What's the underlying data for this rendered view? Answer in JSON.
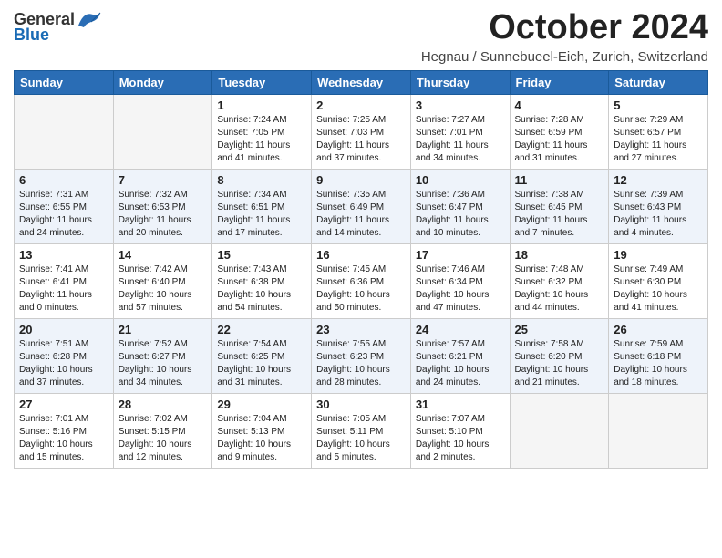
{
  "header": {
    "logo_general": "General",
    "logo_blue": "Blue",
    "month_title": "October 2024",
    "subtitle": "Hegnau / Sunnebueel-Eich, Zurich, Switzerland"
  },
  "days_of_week": [
    "Sunday",
    "Monday",
    "Tuesday",
    "Wednesday",
    "Thursday",
    "Friday",
    "Saturday"
  ],
  "weeks": [
    [
      {
        "day": "",
        "empty": true
      },
      {
        "day": "",
        "empty": true
      },
      {
        "day": "1",
        "sunrise": "Sunrise: 7:24 AM",
        "sunset": "Sunset: 7:05 PM",
        "daylight": "Daylight: 11 hours and 41 minutes."
      },
      {
        "day": "2",
        "sunrise": "Sunrise: 7:25 AM",
        "sunset": "Sunset: 7:03 PM",
        "daylight": "Daylight: 11 hours and 37 minutes."
      },
      {
        "day": "3",
        "sunrise": "Sunrise: 7:27 AM",
        "sunset": "Sunset: 7:01 PM",
        "daylight": "Daylight: 11 hours and 34 minutes."
      },
      {
        "day": "4",
        "sunrise": "Sunrise: 7:28 AM",
        "sunset": "Sunset: 6:59 PM",
        "daylight": "Daylight: 11 hours and 31 minutes."
      },
      {
        "day": "5",
        "sunrise": "Sunrise: 7:29 AM",
        "sunset": "Sunset: 6:57 PM",
        "daylight": "Daylight: 11 hours and 27 minutes."
      }
    ],
    [
      {
        "day": "6",
        "sunrise": "Sunrise: 7:31 AM",
        "sunset": "Sunset: 6:55 PM",
        "daylight": "Daylight: 11 hours and 24 minutes."
      },
      {
        "day": "7",
        "sunrise": "Sunrise: 7:32 AM",
        "sunset": "Sunset: 6:53 PM",
        "daylight": "Daylight: 11 hours and 20 minutes."
      },
      {
        "day": "8",
        "sunrise": "Sunrise: 7:34 AM",
        "sunset": "Sunset: 6:51 PM",
        "daylight": "Daylight: 11 hours and 17 minutes."
      },
      {
        "day": "9",
        "sunrise": "Sunrise: 7:35 AM",
        "sunset": "Sunset: 6:49 PM",
        "daylight": "Daylight: 11 hours and 14 minutes."
      },
      {
        "day": "10",
        "sunrise": "Sunrise: 7:36 AM",
        "sunset": "Sunset: 6:47 PM",
        "daylight": "Daylight: 11 hours and 10 minutes."
      },
      {
        "day": "11",
        "sunrise": "Sunrise: 7:38 AM",
        "sunset": "Sunset: 6:45 PM",
        "daylight": "Daylight: 11 hours and 7 minutes."
      },
      {
        "day": "12",
        "sunrise": "Sunrise: 7:39 AM",
        "sunset": "Sunset: 6:43 PM",
        "daylight": "Daylight: 11 hours and 4 minutes."
      }
    ],
    [
      {
        "day": "13",
        "sunrise": "Sunrise: 7:41 AM",
        "sunset": "Sunset: 6:41 PM",
        "daylight": "Daylight: 11 hours and 0 minutes."
      },
      {
        "day": "14",
        "sunrise": "Sunrise: 7:42 AM",
        "sunset": "Sunset: 6:40 PM",
        "daylight": "Daylight: 10 hours and 57 minutes."
      },
      {
        "day": "15",
        "sunrise": "Sunrise: 7:43 AM",
        "sunset": "Sunset: 6:38 PM",
        "daylight": "Daylight: 10 hours and 54 minutes."
      },
      {
        "day": "16",
        "sunrise": "Sunrise: 7:45 AM",
        "sunset": "Sunset: 6:36 PM",
        "daylight": "Daylight: 10 hours and 50 minutes."
      },
      {
        "day": "17",
        "sunrise": "Sunrise: 7:46 AM",
        "sunset": "Sunset: 6:34 PM",
        "daylight": "Daylight: 10 hours and 47 minutes."
      },
      {
        "day": "18",
        "sunrise": "Sunrise: 7:48 AM",
        "sunset": "Sunset: 6:32 PM",
        "daylight": "Daylight: 10 hours and 44 minutes."
      },
      {
        "day": "19",
        "sunrise": "Sunrise: 7:49 AM",
        "sunset": "Sunset: 6:30 PM",
        "daylight": "Daylight: 10 hours and 41 minutes."
      }
    ],
    [
      {
        "day": "20",
        "sunrise": "Sunrise: 7:51 AM",
        "sunset": "Sunset: 6:28 PM",
        "daylight": "Daylight: 10 hours and 37 minutes."
      },
      {
        "day": "21",
        "sunrise": "Sunrise: 7:52 AM",
        "sunset": "Sunset: 6:27 PM",
        "daylight": "Daylight: 10 hours and 34 minutes."
      },
      {
        "day": "22",
        "sunrise": "Sunrise: 7:54 AM",
        "sunset": "Sunset: 6:25 PM",
        "daylight": "Daylight: 10 hours and 31 minutes."
      },
      {
        "day": "23",
        "sunrise": "Sunrise: 7:55 AM",
        "sunset": "Sunset: 6:23 PM",
        "daylight": "Daylight: 10 hours and 28 minutes."
      },
      {
        "day": "24",
        "sunrise": "Sunrise: 7:57 AM",
        "sunset": "Sunset: 6:21 PM",
        "daylight": "Daylight: 10 hours and 24 minutes."
      },
      {
        "day": "25",
        "sunrise": "Sunrise: 7:58 AM",
        "sunset": "Sunset: 6:20 PM",
        "daylight": "Daylight: 10 hours and 21 minutes."
      },
      {
        "day": "26",
        "sunrise": "Sunrise: 7:59 AM",
        "sunset": "Sunset: 6:18 PM",
        "daylight": "Daylight: 10 hours and 18 minutes."
      }
    ],
    [
      {
        "day": "27",
        "sunrise": "Sunrise: 7:01 AM",
        "sunset": "Sunset: 5:16 PM",
        "daylight": "Daylight: 10 hours and 15 minutes."
      },
      {
        "day": "28",
        "sunrise": "Sunrise: 7:02 AM",
        "sunset": "Sunset: 5:15 PM",
        "daylight": "Daylight: 10 hours and 12 minutes."
      },
      {
        "day": "29",
        "sunrise": "Sunrise: 7:04 AM",
        "sunset": "Sunset: 5:13 PM",
        "daylight": "Daylight: 10 hours and 9 minutes."
      },
      {
        "day": "30",
        "sunrise": "Sunrise: 7:05 AM",
        "sunset": "Sunset: 5:11 PM",
        "daylight": "Daylight: 10 hours and 5 minutes."
      },
      {
        "day": "31",
        "sunrise": "Sunrise: 7:07 AM",
        "sunset": "Sunset: 5:10 PM",
        "daylight": "Daylight: 10 hours and 2 minutes."
      },
      {
        "day": "",
        "empty": true
      },
      {
        "day": "",
        "empty": true
      }
    ]
  ]
}
